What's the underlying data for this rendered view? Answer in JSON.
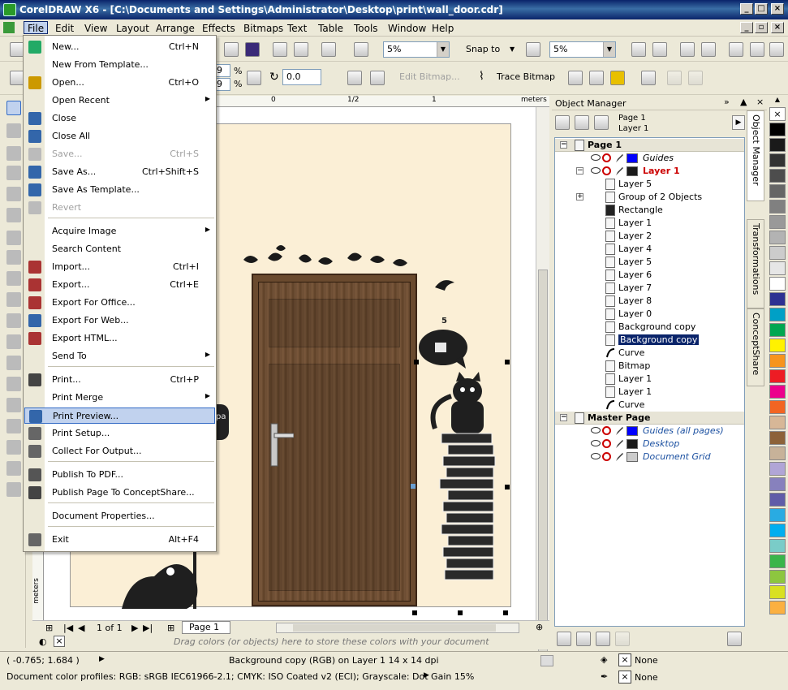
{
  "window": {
    "title": "CorelDRAW X6 - [C:\\Documents and Settings\\Administrator\\Desktop\\print\\wall_door.cdr]",
    "controls": [
      "_",
      "□",
      "×"
    ]
  },
  "menubar": {
    "items": [
      "File",
      "Edit",
      "View",
      "Layout",
      "Arrange",
      "Effects",
      "Bitmaps",
      "Text",
      "Table",
      "Tools",
      "Window",
      "Help"
    ],
    "active": "File"
  },
  "toolbar1": {
    "zoom_left": "5%",
    "snap_to": "Snap to",
    "zoom_right": "5%"
  },
  "toolbar2": {
    "angle": "0.0",
    "edit_bitmap": "Edit Bitmap...",
    "trace_bitmap": "Trace Bitmap",
    "dim_a": "9",
    "dim_b": "9",
    "pct": "%"
  },
  "ruler": {
    "unit": "meters",
    "ticks": [
      "0",
      "1/2",
      "1"
    ]
  },
  "canvas": {
    "bubble_number": "5",
    "speech_text": "pa"
  },
  "file_menu": {
    "items": [
      {
        "label": "New...",
        "shortcut": "Ctrl+N"
      },
      {
        "label": "New From Template...",
        "shortcut": ""
      },
      {
        "label": "Open...",
        "shortcut": "Ctrl+O"
      },
      {
        "label": "Open Recent",
        "shortcut": ""
      },
      {
        "label": "Close",
        "shortcut": ""
      },
      {
        "label": "Close All",
        "shortcut": ""
      },
      {
        "label": "Save...",
        "shortcut": "Ctrl+S"
      },
      {
        "label": "Save As...",
        "shortcut": "Ctrl+Shift+S"
      },
      {
        "label": "Save As Template...",
        "shortcut": ""
      },
      {
        "label": "Revert",
        "shortcut": ""
      },
      {
        "label": "Acquire Image",
        "shortcut": ""
      },
      {
        "label": "Search Content",
        "shortcut": ""
      },
      {
        "label": "Import...",
        "shortcut": "Ctrl+I"
      },
      {
        "label": "Export...",
        "shortcut": "Ctrl+E"
      },
      {
        "label": "Export For Office...",
        "shortcut": ""
      },
      {
        "label": "Export For Web...",
        "shortcut": ""
      },
      {
        "label": "Export HTML...",
        "shortcut": ""
      },
      {
        "label": "Send To",
        "shortcut": ""
      },
      {
        "label": "Print...",
        "shortcut": "Ctrl+P"
      },
      {
        "label": "Print Merge",
        "shortcut": ""
      },
      {
        "label": "Print Preview...",
        "shortcut": ""
      },
      {
        "label": "Print Setup...",
        "shortcut": ""
      },
      {
        "label": "Collect For Output...",
        "shortcut": ""
      },
      {
        "label": "Publish To PDF...",
        "shortcut": ""
      },
      {
        "label": "Publish Page To ConceptShare...",
        "shortcut": ""
      },
      {
        "label": "Document Properties...",
        "shortcut": ""
      },
      {
        "label": "Exit",
        "shortcut": "Alt+F4"
      }
    ]
  },
  "object_manager": {
    "title": "Object Manager",
    "page_label": "Page 1",
    "layer_label": "Layer 1",
    "tree": [
      {
        "text": "Page 1"
      },
      {
        "text": "Guides"
      },
      {
        "text": "Layer 1"
      },
      {
        "text": "Layer 5"
      },
      {
        "text": "Group of 2 Objects"
      },
      {
        "text": "Rectangle"
      },
      {
        "text": "Layer 1"
      },
      {
        "text": "Layer 2"
      },
      {
        "text": "Layer 4"
      },
      {
        "text": "Layer 5"
      },
      {
        "text": "Layer 6"
      },
      {
        "text": "Layer 7"
      },
      {
        "text": "Layer 8"
      },
      {
        "text": "Layer 0"
      },
      {
        "text": "Background copy"
      },
      {
        "text": "Background copy"
      },
      {
        "text": "Curve"
      },
      {
        "text": "Bitmap"
      },
      {
        "text": "Layer 1"
      },
      {
        "text": "Layer 1"
      },
      {
        "text": "Curve"
      },
      {
        "text": "Master Page"
      },
      {
        "text": "Guides (all pages)"
      },
      {
        "text": "Desktop"
      },
      {
        "text": "Document Grid"
      }
    ]
  },
  "dock_tabs": [
    "Object Manager",
    "Transformations",
    "ConceptShare"
  ],
  "navigator": {
    "page_count": "1 of 1",
    "page_tab": "Page 1"
  },
  "colorbar_hint": "Drag colors (or objects) here to store these colors with your document",
  "status": {
    "coords": "( -0.765; 1.684 )",
    "selection": "Background copy (RGB) on Layer 1 14 x 14 dpi",
    "profiles": "Document color profiles: RGB: sRGB IEC61966-2.1; CMYK: ISO Coated v2 (ECI); Grayscale: Dot Gain 15%",
    "fill": "None",
    "outline": "None"
  },
  "colors": {
    "titlebar": "#0a246a",
    "page_bg": "#fbefd6",
    "menu_highlight": "#c1d2ee",
    "selected_row": "#0a246a",
    "layer_red": "#cc0000",
    "guides_blue": "#0000ff"
  },
  "palette": [
    "#ffffff",
    "#000000",
    "#1a1a1a",
    "#333333",
    "#4d4d4d",
    "#666666",
    "#808080",
    "#999999",
    "#b3b3b3",
    "#cccccc",
    "#e6e6e6",
    "#ffffff",
    "#2e3192",
    "#00a0c6",
    "#00a650",
    "#fff200",
    "#f7941d",
    "#ed1c24",
    "#ec008c",
    "#f26522",
    "#d7b797",
    "#8c6239",
    "#c7b299",
    "#b0a5d6",
    "#8781bd",
    "#605ca8",
    "#29abe2",
    "#00aeef",
    "#7accc8",
    "#39b54a",
    "#8dc63f",
    "#d9e021",
    "#fbb040"
  ]
}
